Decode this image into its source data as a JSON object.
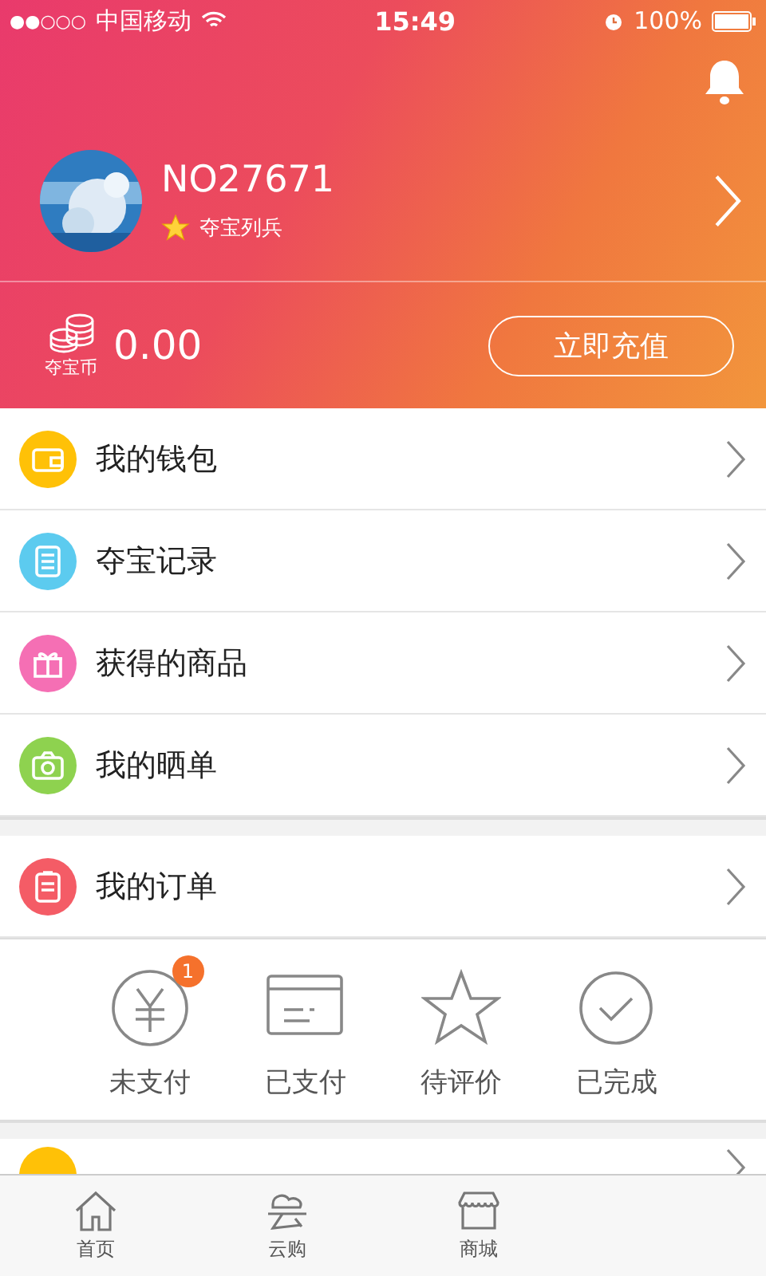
{
  "status_bar": {
    "signal_dots": "●●○○○",
    "carrier": "中国移动",
    "time": "15:49",
    "battery": "100%"
  },
  "profile": {
    "name": "NO27671",
    "rank": "夺宝列兵"
  },
  "balance": {
    "amount": "0.00",
    "unit": "夺宝币",
    "action": "立即充值"
  },
  "menu": [
    {
      "kind": "wallet",
      "label": "我的钱包",
      "color": "#ffc107"
    },
    {
      "kind": "record",
      "label": "夺宝记录",
      "color": "#5ccbef"
    },
    {
      "kind": "gift",
      "label": "获得的商品",
      "color": "#f56fb4"
    },
    {
      "kind": "camera",
      "label": "我的晒单",
      "color": "#8ed24f"
    }
  ],
  "orders": {
    "label": "我的订单",
    "color": "#f45c66",
    "statuses": [
      {
        "kind": "yuan",
        "label": "未支付",
        "badge": "1"
      },
      {
        "kind": "card",
        "label": "已支付"
      },
      {
        "kind": "star",
        "label": "待评价"
      },
      {
        "kind": "check",
        "label": "已完成"
      }
    ]
  },
  "help_row": {
    "color": "#ffc107"
  },
  "tab_bar": [
    {
      "kind": "home",
      "label": "首页",
      "selected": false
    },
    {
      "kind": "cloud",
      "label": "云购",
      "selected": false
    },
    {
      "kind": "shop",
      "label": "商城",
      "selected": false
    }
  ]
}
